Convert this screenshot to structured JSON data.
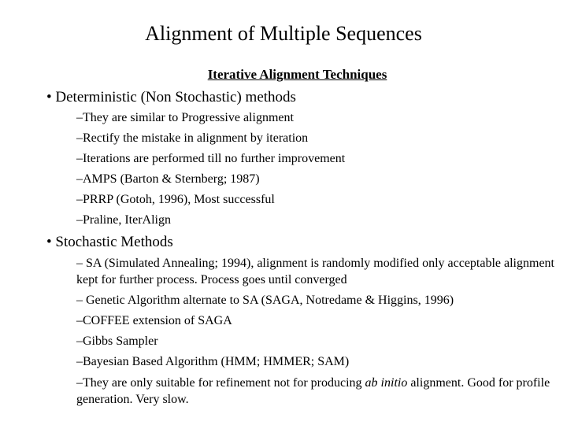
{
  "slide": {
    "title": "Alignment of Multiple Sequences",
    "subtitle": "Iterative Alignment Techniques",
    "sections": [
      {
        "heading": "• Deterministic (Non Stochastic) methods",
        "items": [
          "–They are similar to Progressive alignment",
          "–Rectify the mistake in alignment by iteration",
          "–Iterations are performed till no further improvement",
          "–AMPS (Barton & Sternberg; 1987)",
          "–PRRP (Gotoh, 1996), Most successful",
          "–Praline, IterAlign"
        ]
      },
      {
        "heading": "• Stochastic Methods",
        "items": [
          "– SA (Simulated Annealing; 1994), alignment is randomly modified only acceptable alignment kept for further process. Process goes until converged",
          "– Genetic Algorithm alternate to SA (SAGA, Notredame & Higgins, 1996)",
          "–COFFEE extension of SAGA",
          "–Gibbs Sampler",
          "–Bayesian Based Algorithm (HMM; HMMER; SAM)"
        ],
        "last_item": {
          "before": "–They are only suitable for refinement not for producing ",
          "italic": "ab initio",
          "after": " alignment. Good for profile generation. Very slow."
        }
      }
    ]
  }
}
